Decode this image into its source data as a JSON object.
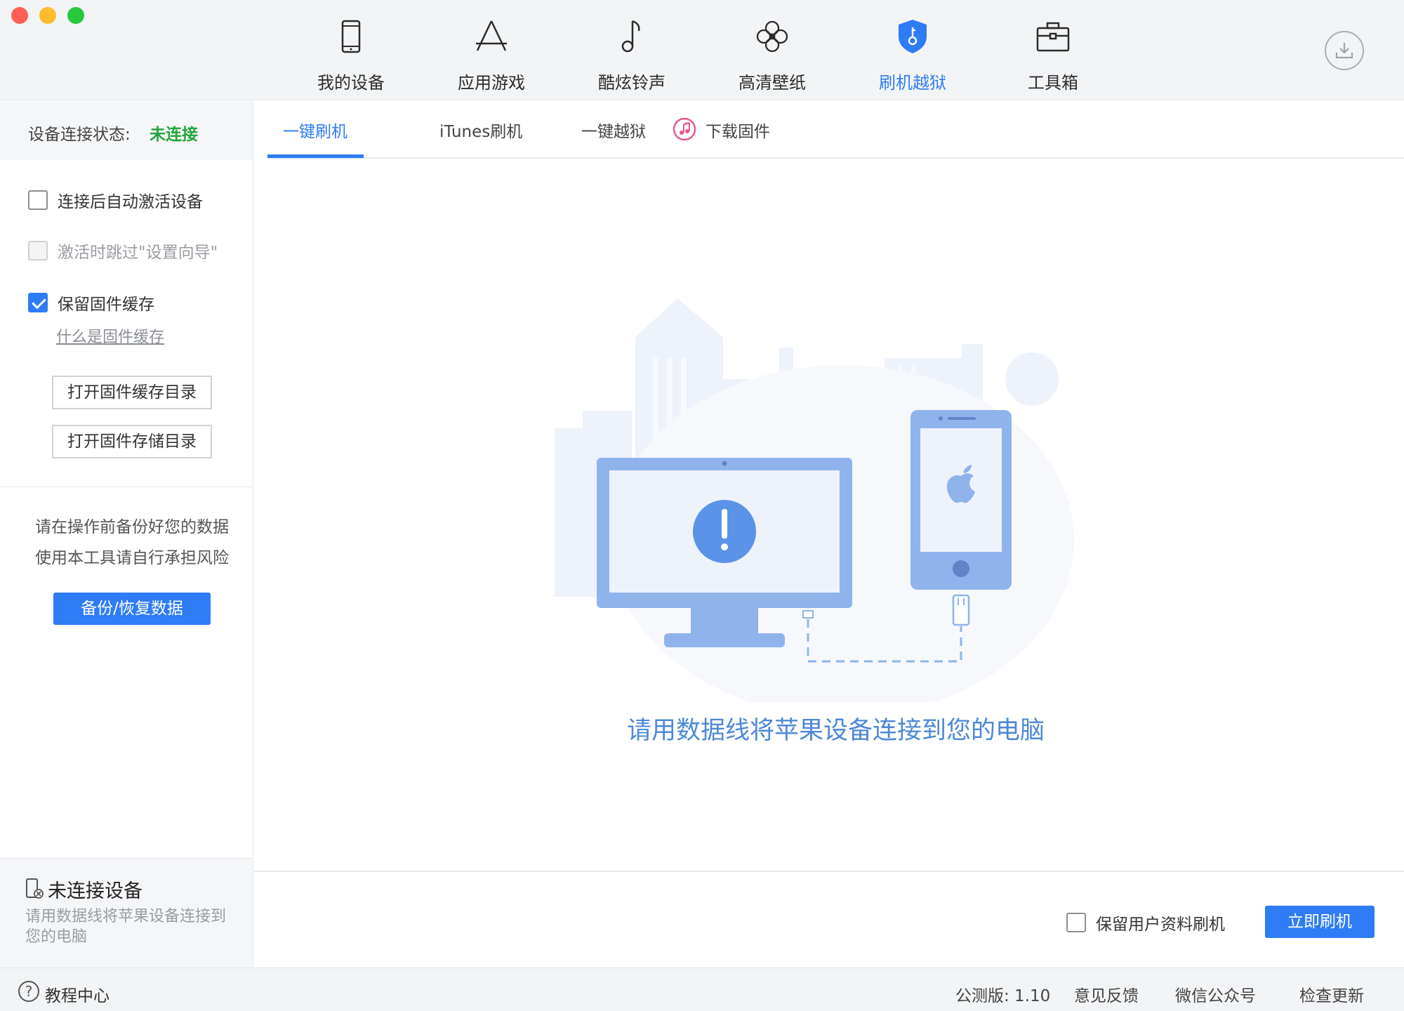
{
  "window": {
    "traffic_lights": {
      "close": "#fe5f57",
      "minimize": "#febc2e",
      "zoom": "#28c840"
    }
  },
  "nav": {
    "items": [
      {
        "label": "我的设备",
        "icon": "phone-icon"
      },
      {
        "label": "应用游戏",
        "icon": "app-store-icon"
      },
      {
        "label": "酷炫铃声",
        "icon": "music-note-icon"
      },
      {
        "label": "高清壁纸",
        "icon": "flower-icon"
      },
      {
        "label": "刷机越狱",
        "icon": "shield-key-icon",
        "active": true
      },
      {
        "label": "工具箱",
        "icon": "toolbox-icon"
      }
    ],
    "download_icon": "download-icon"
  },
  "sidebar": {
    "status_label": "设备连接状态:",
    "status_value": "未连接",
    "options": [
      {
        "label": "连接后自动激活设备",
        "checked": false,
        "disabled": false
      },
      {
        "label": "激活时跳过\"设置向导\"",
        "checked": false,
        "disabled": true
      },
      {
        "label": "保留固件缓存",
        "checked": true,
        "disabled": false
      }
    ],
    "cache_link": "什么是固件缓存",
    "open_cache_dir": "打开固件缓存目录",
    "open_storage_dir": "打开固件存储目录",
    "warning_line1": "请在操作前备份好您的数据",
    "warning_line2": "使用本工具请自行承担风险",
    "backup_button": "备份/恢复数据",
    "device_title": "未连接设备",
    "device_desc": "请用数据线将苹果设备连接到您的电脑"
  },
  "tabs": [
    {
      "label": "一键刷机",
      "active": true
    },
    {
      "label": "iTunes刷机",
      "icon": "itunes-icon"
    },
    {
      "label": "一键越狱"
    },
    {
      "label": "下载固件"
    }
  ],
  "main": {
    "connect_message": "请用数据线将苹果设备连接到您的电脑",
    "keep_user_data_label": "保留用户资料刷机",
    "keep_user_data_checked": false,
    "flash_button": "立即刷机"
  },
  "footer": {
    "help": "教程中心",
    "version": "公测版: 1.10",
    "feedback": "意见反馈",
    "wechat": "微信公众号",
    "update": "检查更新"
  },
  "colors": {
    "accent": "#2e7cf6",
    "status_disconnected": "#23a43b",
    "illustration_blue": "#8fb4ec"
  }
}
